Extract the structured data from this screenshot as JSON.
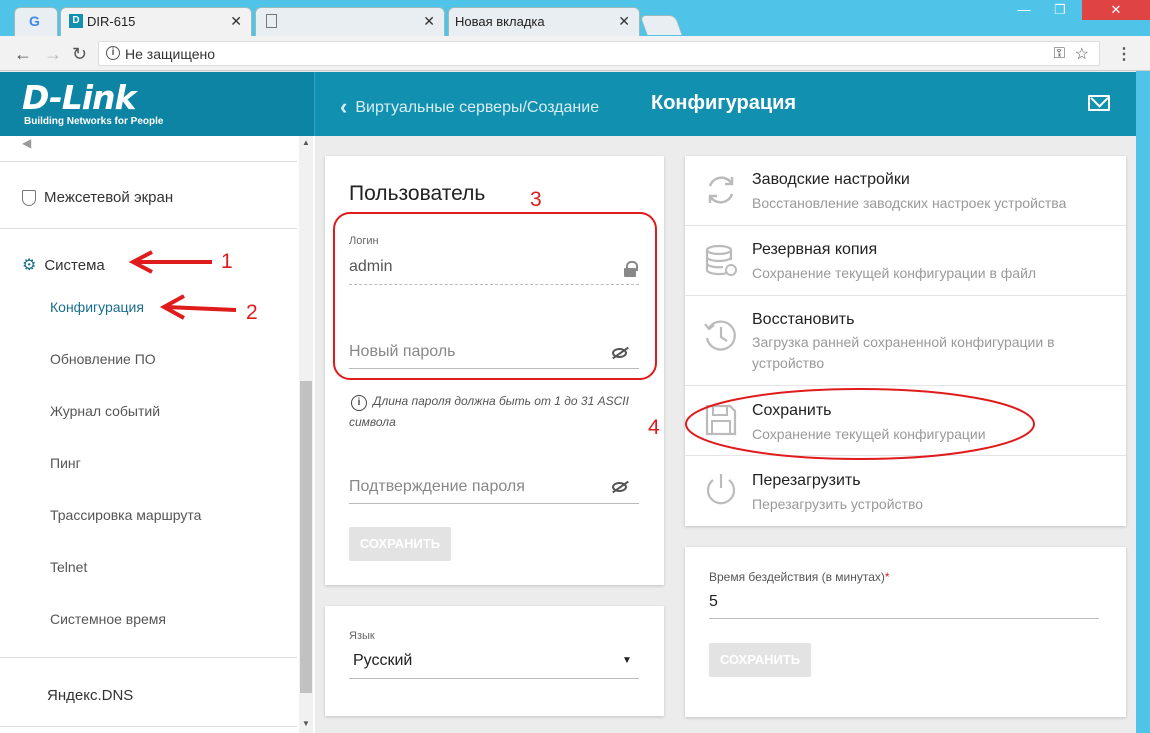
{
  "browser": {
    "tabs": [
      {
        "title": ""
      },
      {
        "title": "DIR-615"
      },
      {
        "title": ""
      },
      {
        "title": "Новая вкладка"
      }
    ],
    "security_text": "Не защищено"
  },
  "header": {
    "logo": "D-Link",
    "logo_sub": "Building Networks for People",
    "back_label": "Виртуальные серверы/Создание",
    "page_title": "Конфигурация"
  },
  "sidebar": {
    "firewall": "Межсетевой экран",
    "system": "Система",
    "subitems": [
      "Конфигурация",
      "Обновление ПО",
      "Журнал событий",
      "Пинг",
      "Трассировка маршрута",
      "Telnet",
      "Системное время"
    ],
    "yandex": "Яндекс.DNS"
  },
  "user_card": {
    "title": "Пользователь",
    "login_label": "Логин",
    "login_value": "admin",
    "new_password_placeholder": "Новый пароль",
    "hint": "Длина пароля должна быть от 1 до 31 ASCII символа",
    "confirm_placeholder": "Подтверждение пароля",
    "save_label": "СОХРАНИТЬ"
  },
  "lang_card": {
    "label": "Язык",
    "value": "Русский"
  },
  "config_card": {
    "rows": [
      {
        "title": "Заводские настройки",
        "desc": "Восстановление заводских настроек устройства"
      },
      {
        "title": "Резервная копия",
        "desc": "Сохранение текущей конфигурации в файл"
      },
      {
        "title": "Восстановить",
        "desc": "Загрузка ранней сохраненной конфигурации в устройство"
      },
      {
        "title": "Сохранить",
        "desc": "Сохранение текущей конфигурации"
      },
      {
        "title": "Перезагрузить",
        "desc": "Перезагрузить устройство"
      }
    ]
  },
  "idle_card": {
    "label": "Время бездействия (в минутах)",
    "required": "*",
    "value": "5",
    "save_label": "СОХРАНИТЬ"
  },
  "annotations": [
    "1",
    "2",
    "3",
    "4"
  ],
  "colors": {
    "header": "#1290af",
    "accent": "#1a6d8e",
    "annotation": "#e01b1b"
  }
}
